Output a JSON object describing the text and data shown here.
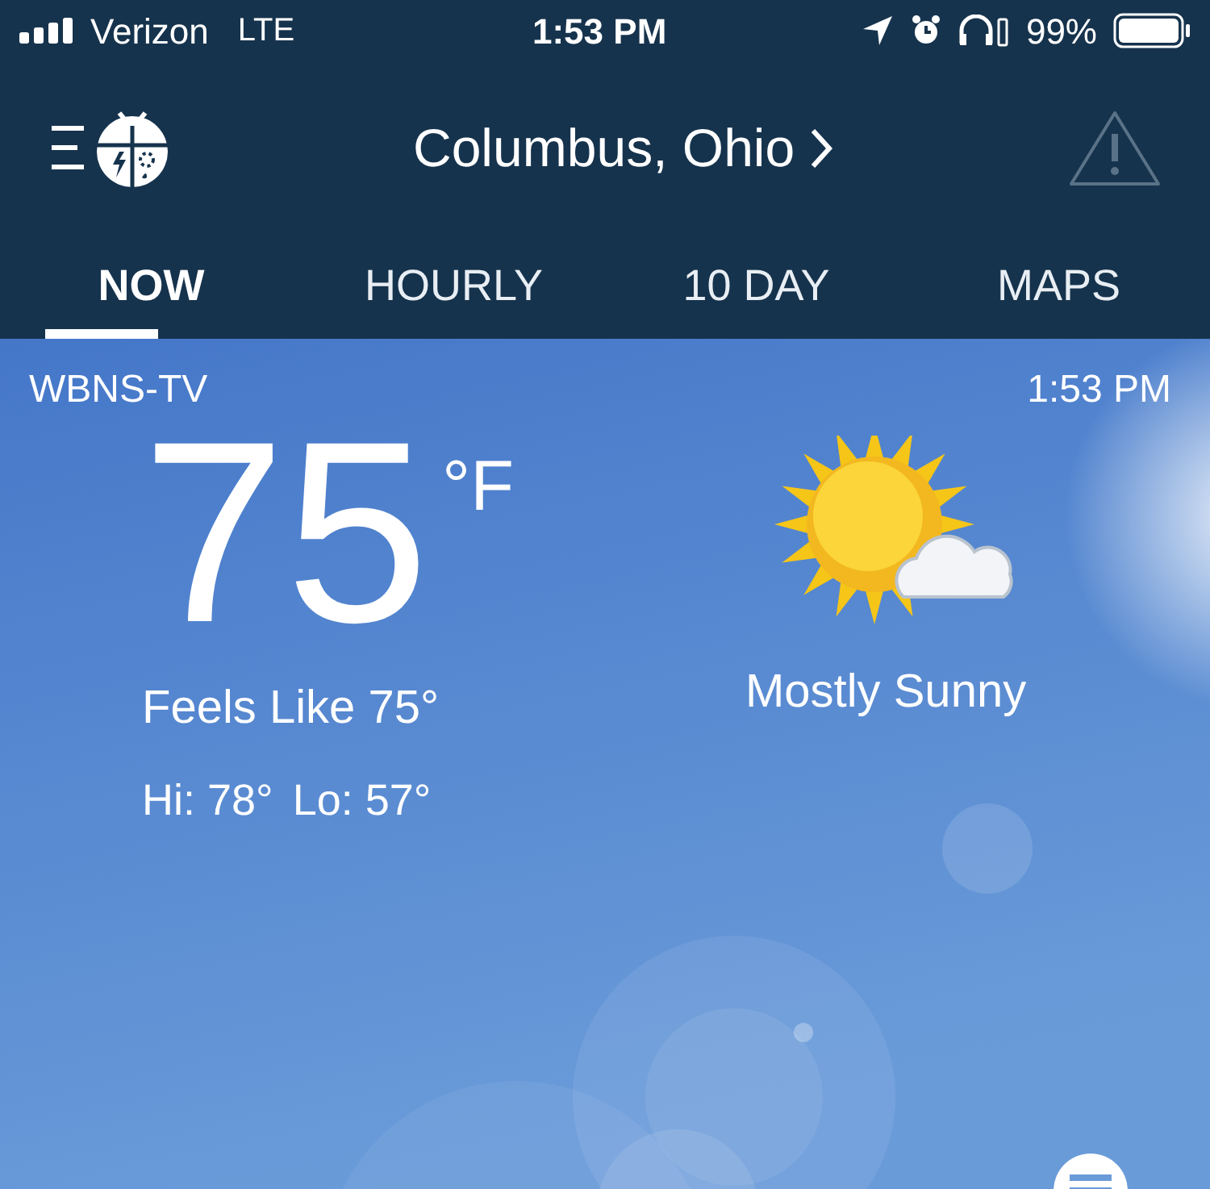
{
  "status_bar": {
    "carrier": "Verizon",
    "network": "LTE",
    "time": "1:53 PM",
    "battery": "99%"
  },
  "header": {
    "location": "Columbus,  Ohio"
  },
  "tabs": [
    {
      "label": "NOW",
      "selected": true
    },
    {
      "label": "HOURLY",
      "selected": false
    },
    {
      "label": "10  DAY",
      "selected": false
    },
    {
      "label": "MAPS",
      "selected": false
    }
  ],
  "station": "WBNS-TV",
  "updated_time": "1:53  PM",
  "current": {
    "temperature": "75",
    "unit": "°F",
    "feels_like": "Feels  Like  75°",
    "hi": "Hi: 78°",
    "lo": "Lo: 57°",
    "condition": "Mostly  Sunny"
  }
}
